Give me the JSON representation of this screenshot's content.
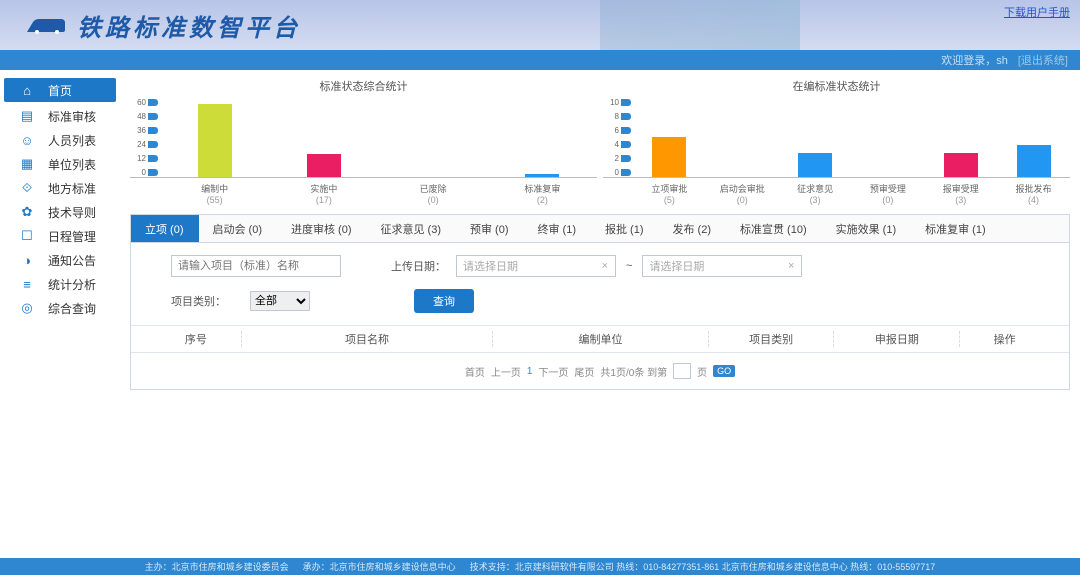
{
  "header": {
    "title": "铁路标准数智平台",
    "manual_link": "下载用户手册"
  },
  "topbar": {
    "welcome": "欢迎登录，sh",
    "logout": "[退出系统]"
  },
  "sidebar": {
    "items": [
      {
        "label": "首页",
        "icon": "⌂"
      },
      {
        "label": "标准审核",
        "icon": "▤"
      },
      {
        "label": "人员列表",
        "icon": "☺"
      },
      {
        "label": "单位列表",
        "icon": "▦"
      },
      {
        "label": "地方标准",
        "icon": "⟐"
      },
      {
        "label": "技术导则",
        "icon": "✿"
      },
      {
        "label": "日程管理",
        "icon": "☐"
      },
      {
        "label": "通知公告",
        "icon": "◑"
      },
      {
        "label": "统计分析",
        "icon": "≡"
      },
      {
        "label": "综合查询",
        "icon": "◎"
      }
    ]
  },
  "charts": {
    "left_title": "标准状态综合统计",
    "right_title": "在编标准状态统计"
  },
  "chart_data": [
    {
      "type": "bar",
      "title": "标准状态综合统计",
      "categories": [
        "编制中",
        "实施中",
        "已废除",
        "标准复审"
      ],
      "values": [
        55,
        17,
        0,
        2
      ],
      "colors": [
        "#cddc39",
        "#e91e63",
        "#ff9800",
        "#2196f3"
      ],
      "ylim": [
        0,
        60
      ],
      "yticks": [
        0,
        12,
        24,
        36,
        48,
        60
      ]
    },
    {
      "type": "bar",
      "title": "在编标准状态统计",
      "categories": [
        "立项审批",
        "启动会审批",
        "征求意见",
        "预审受理",
        "报审受理",
        "报批发布"
      ],
      "values": [
        5,
        0,
        3,
        0,
        3,
        4
      ],
      "colors": [
        "#ff9800",
        "#cddc39",
        "#2196f3",
        "#e91e63",
        "#e91e63",
        "#2196f3"
      ],
      "ylim": [
        0,
        10
      ],
      "yticks": [
        0,
        2,
        4,
        6,
        8,
        10
      ]
    }
  ],
  "tabs": [
    {
      "label": "立项 (0)"
    },
    {
      "label": "启动会 (0)"
    },
    {
      "label": "进度审核 (0)"
    },
    {
      "label": "征求意见 (3)"
    },
    {
      "label": "预审 (0)"
    },
    {
      "label": "终审 (1)"
    },
    {
      "label": "报批 (1)"
    },
    {
      "label": "发布 (2)"
    },
    {
      "label": "标准宣贯 (10)"
    },
    {
      "label": "实施效果 (1)"
    },
    {
      "label": "标准复审 (1)"
    }
  ],
  "filter": {
    "search_placeholder": "请输入项目（标准）名称",
    "upload_label": "上传日期：",
    "date_placeholder": "请选择日期",
    "tilde": "~",
    "category_label": "项目类别：",
    "category_value": "全部",
    "search_btn": "查询"
  },
  "table": {
    "cols": [
      "序号",
      "项目名称",
      "编制单位",
      "项目类别",
      "申报日期",
      "操作"
    ]
  },
  "pager": {
    "first": "首页",
    "prev": "上一页",
    "current": "1",
    "next": "下一页",
    "last": "尾页",
    "total": "共1页/0条 到第",
    "page_suffix": "页",
    "go": "GO"
  },
  "footer": {
    "host": "主办：北京市住房和城乡建设委员会",
    "undertake": "承办：北京市住房和城乡建设信息中心",
    "tech": "技术支持：北京建科研软件有限公司 热线：010-84277351-861  北京市住房和城乡建设信息中心 热线：010-55597717"
  }
}
